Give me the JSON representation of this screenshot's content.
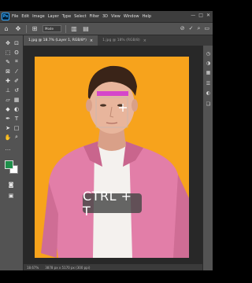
{
  "menubar": {
    "logo": "Ps",
    "items": [
      "File",
      "Edit",
      "Image",
      "Layer",
      "Type",
      "Select",
      "Filter",
      "3D",
      "View",
      "Window",
      "Help"
    ],
    "window_controls": [
      "—",
      "□",
      "✕"
    ]
  },
  "options": {
    "mode_field": "Mode"
  },
  "tabs": [
    {
      "label": "1.jpg @ 18.7% (Layer 1, RGB/8*)",
      "active": true
    },
    {
      "label": "1.jpg @ 18% (RGB/8)",
      "active": false
    }
  ],
  "status": {
    "zoom": "18.67%",
    "doc_info": "3878 px x 5170 px (300 ppi)"
  },
  "overlay": {
    "shortcut": "CTRL + T"
  },
  "colors": {
    "canvas_bg": "#f7a31c",
    "foreground": "#1f8f4a",
    "background": "#ffffff",
    "shirt": "#e27ea8",
    "selection": "#d02ad6"
  },
  "icons": {
    "toolbar": [
      "home-icon",
      "move-icon",
      "marquee-icon",
      "lasso-icon",
      "quick-select-icon",
      "crop-icon",
      "frame-icon",
      "eyedropper-icon",
      "healing-icon",
      "brush-icon",
      "stamp-icon",
      "history-brush-icon",
      "eraser-icon",
      "gradient-icon",
      "blur-icon",
      "dodge-icon",
      "pen-icon",
      "type-icon",
      "path-select-icon",
      "shape-icon",
      "hand-icon",
      "zoom-icon",
      "more-tools-icon"
    ],
    "right_strip": [
      "history-icon",
      "color-icon",
      "swatches-icon",
      "properties-icon",
      "adjust-icon",
      "layers-icon"
    ]
  }
}
